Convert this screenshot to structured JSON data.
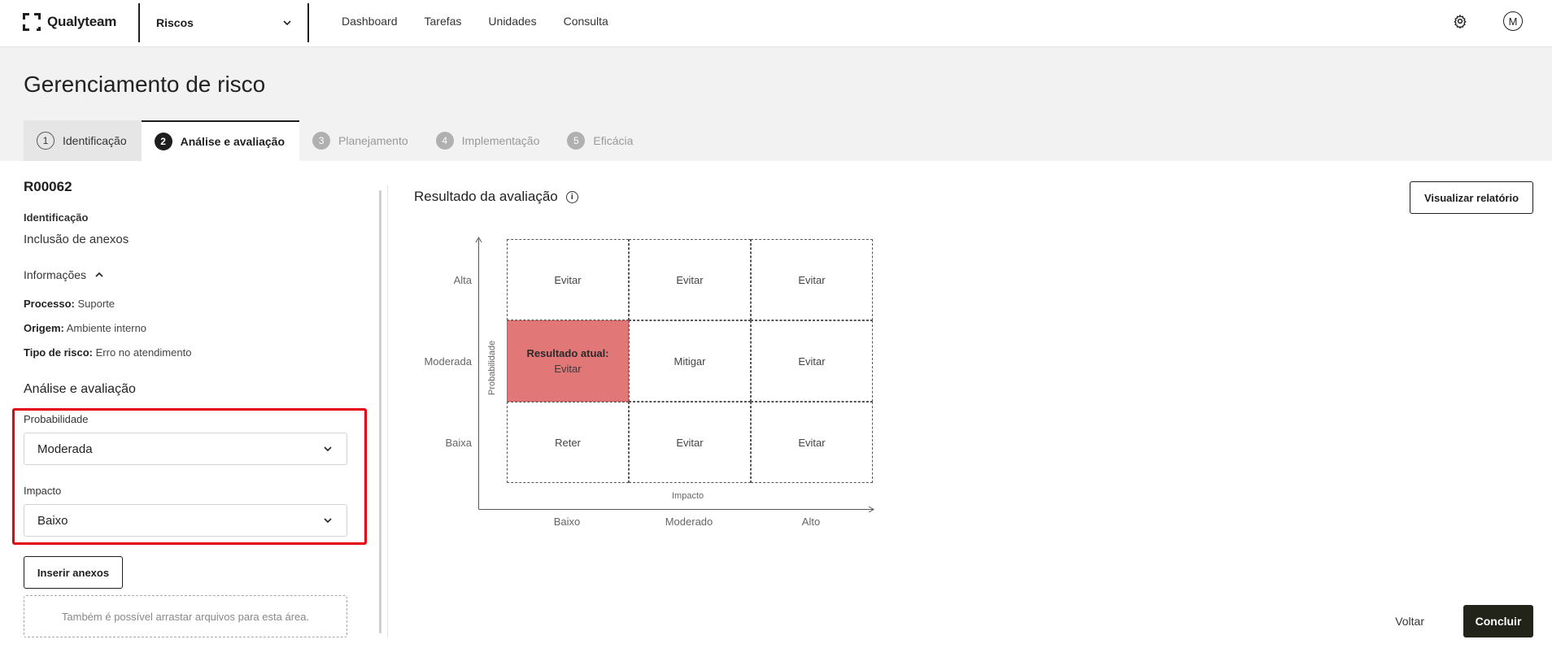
{
  "app": {
    "name": "Qualyteam",
    "module": "Riscos"
  },
  "nav": {
    "items": [
      "Dashboard",
      "Tarefas",
      "Unidades",
      "Consulta"
    ]
  },
  "user": {
    "initial": "M"
  },
  "page": {
    "title": "Gerenciamento de risco"
  },
  "steps": [
    {
      "num": "1",
      "label": "Identificação",
      "state": "done"
    },
    {
      "num": "2",
      "label": "Análise e avaliação",
      "state": "active"
    },
    {
      "num": "3",
      "label": "Planejamento",
      "state": "pending"
    },
    {
      "num": "4",
      "label": "Implementação",
      "state": "pending"
    },
    {
      "num": "5",
      "label": "Eficácia",
      "state": "pending"
    }
  ],
  "risk": {
    "code": "R00062",
    "identification_label": "Identificação",
    "identification_value": "Inclusão de anexos",
    "info_toggle": "Informações",
    "process_label": "Processo:",
    "process_value": "Suporte",
    "origin_label": "Origem:",
    "origin_value": "Ambiente interno",
    "type_label": "Tipo de risco:",
    "type_value": "Erro no atendimento"
  },
  "analysis": {
    "section_title": "Análise e avaliação",
    "probability_label": "Probabilidade",
    "probability_value": "Moderada",
    "impact_label": "Impacto",
    "impact_value": "Baixo",
    "attach_button": "Inserir anexos",
    "dropzone_text": "Também é possível arrastar arquivos para esta área."
  },
  "result": {
    "title": "Resultado da avaliação",
    "report_button": "Visualizar relatório",
    "y_axis_name": "Probabilidade",
    "x_axis_name": "Impacto",
    "rows": [
      "Alta",
      "Moderada",
      "Baixa"
    ],
    "cols": [
      "Baixo",
      "Moderado",
      "Alto"
    ],
    "matrix": [
      [
        "Evitar",
        "Evitar",
        "Evitar"
      ],
      [
        "Evitar",
        "Mitigar",
        "Evitar"
      ],
      [
        "Reter",
        "Evitar",
        "Evitar"
      ]
    ],
    "current_label": "Resultado atual:",
    "current_row": 1,
    "current_col": 0,
    "current_color": "#e27778"
  },
  "footer": {
    "back": "Voltar",
    "finish": "Concluir"
  }
}
